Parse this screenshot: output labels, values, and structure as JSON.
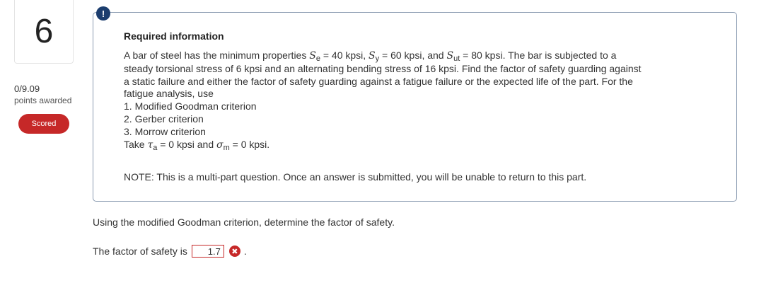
{
  "question": {
    "number": "6",
    "score": "0/9.09",
    "points_label": "points awarded",
    "badge": "Scored",
    "alert_glyph": "!"
  },
  "info": {
    "heading": "Required information",
    "line1_a": "A bar of steel has the minimum properties ",
    "se_sym": "S",
    "se_sub": "e",
    "line1_b": " = 40 kpsi, ",
    "sy_sym": "S",
    "sy_sub": "y",
    "line1_c": " = 60 kpsi, and ",
    "sut_sym": "S",
    "sut_sub": "ut",
    "line1_d": " = 80 kpsi. The bar is subjected to a",
    "line2": "steady torsional stress of 6 kpsi and an alternating bending stress of 16 kpsi. Find the factor of safety guarding against",
    "line3": "a static failure and either the factor of safety guarding against a fatigue failure or the expected life of the part. For the",
    "line4": "fatigue analysis, use",
    "item1": "1. Modified Goodman criterion",
    "item2": "2. Gerber criterion",
    "item3": "3. Morrow criterion",
    "take_a": "Take ",
    "ta_sym": "τ",
    "ta_sub": "a",
    "take_b": " = 0 kpsi and ",
    "sm_sym": "σ",
    "sm_sub": "m",
    "take_c": " = 0 kpsi.",
    "note": "NOTE: This is a multi-part question. Once an answer is submitted, you will be unable to return to this part."
  },
  "prompt": "Using the modified Goodman criterion, determine the factor of safety.",
  "answer": {
    "label": "The factor of safety is",
    "value": "1.7",
    "status_glyph": "✖",
    "status": "incorrect",
    "trailing": "."
  },
  "colors": {
    "accent_red": "#c62828",
    "alert_blue": "#1b3d6e",
    "box_border": "#8a9bb1"
  }
}
